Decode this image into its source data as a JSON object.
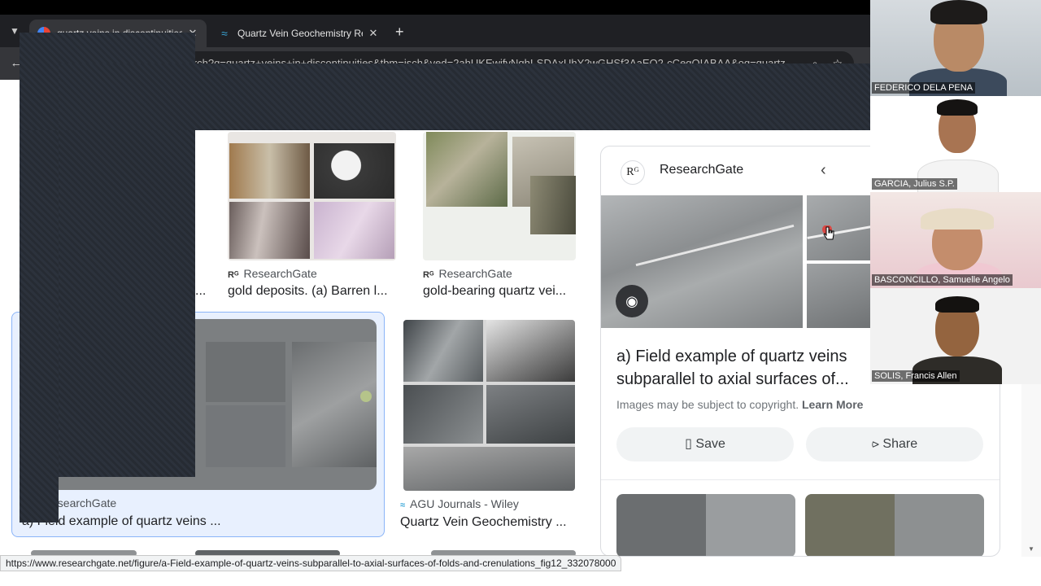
{
  "browser": {
    "tabs": [
      {
        "title": "quartz veins in discontinuities - ",
        "active": true,
        "icon": "google-favicon"
      },
      {
        "title": "Quartz Vein Geochemistry Reco",
        "active": false,
        "icon": "agu-favicon"
      }
    ],
    "new_tab_label": "+",
    "url": "google.com/search?q=quartz+veins+in+discontinuities&tbm=isch&ved=2ahUKEwjfvNqhI-SDAxUhY2wGHSf3AaEQ2-cCegQIABAA&oq=quartz..."
  },
  "results": {
    "row1": [
      {
        "source": "ResearchGate",
        "caption": "gold deposits. (a) Barren l..."
      },
      {
        "source": "ResearchGate",
        "caption": "gold-bearing quartz vei..."
      }
    ],
    "row2": [
      {
        "source": "esearchGate",
        "caption": "a) Field example of quartz veins ..."
      },
      {
        "source": "AGU Journals - Wiley",
        "caption": "Quartz Vein Geochemistry ..."
      }
    ],
    "partial_caption": "..."
  },
  "preview": {
    "source": "ResearchGate",
    "logo_text": "Rᴳ",
    "title": "a) Field example of quartz veins subparallel to axial surfaces of...",
    "copyright_text": "Images may be subject to copyright.",
    "learn_more": "Learn More",
    "save_label": "Save",
    "share_label": "Share"
  },
  "status_url": "https://www.researchgate.net/figure/a-Field-example-of-quartz-veins-subparallel-to-axial-surfaces-of-folds-and-crenulations_fig12_332078000",
  "participants": [
    {
      "name": "FEDERICO DELA PENA"
    },
    {
      "name": "GARCIA, Julius S.P."
    },
    {
      "name": "BASCONCILLO, Samuelle Angelo"
    },
    {
      "name": "SOLIS, Francis Allen"
    }
  ],
  "colors": {
    "accent_blue": "#1a73e8",
    "selection_bg": "#e8f0fe",
    "chrome_dark": "#35363a"
  }
}
